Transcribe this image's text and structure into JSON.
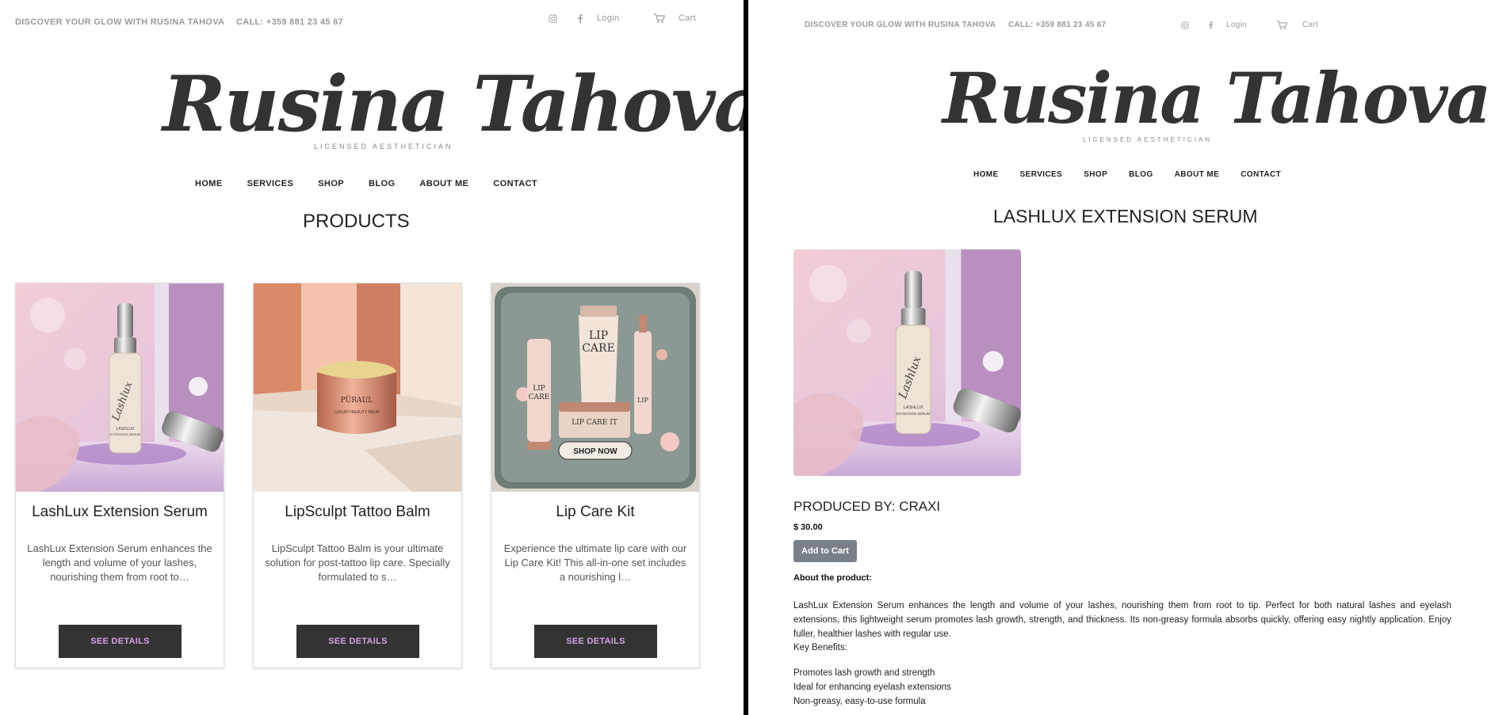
{
  "left": {
    "topbar": {
      "tagline": "DISCOVER YOUR GLOW WITH RUSINA TAHOVA",
      "phone": "CALL: +359 881 23 45 67",
      "login": "Login",
      "cart": "Cart"
    },
    "logo": {
      "name": "Rusina Tahova",
      "subtitle": "LICENSED AESTHETICIAN"
    },
    "nav": [
      "HOME",
      "SERVICES",
      "SHOP",
      "BLOG",
      "ABOUT ME",
      "CONTACT"
    ],
    "page_title": "PRODUCTS",
    "products": [
      {
        "title": "LashLux Extension Serum",
        "description": "LashLux Extension Serum enhances the length and volume of your lashes, nourishing them from root to…",
        "button": "SEE DETAILS",
        "image_label": "LASHLUX EXTENSION SERUM"
      },
      {
        "title": "LipSculpt Tattoo Balm",
        "description": "LipSculpt Tattoo Balm is your ultimate solution for post-tattoo lip care. Specially formulated to s…",
        "button": "SEE DETAILS",
        "image_label": "PURAUL LUXURY BEAUTY BALM"
      },
      {
        "title": "Lip Care Kit",
        "description": "Experience the ultimate lip care with our Lip Care Kit! This all-in-one set includes a nourishing l…",
        "button": "SEE DETAILS",
        "image_label": "SHOP NOW"
      }
    ]
  },
  "right": {
    "topbar": {
      "tagline": "DISCOVER YOUR GLOW WITH RUSINA TAHOVA",
      "phone": "CALL: +359 881 23 45 67",
      "login": "Login",
      "cart": "Cart"
    },
    "logo": {
      "name": "Rusina Tahova",
      "subtitle": "LICENSED AESTHETICIAN"
    },
    "nav": [
      "HOME",
      "SERVICES",
      "SHOP",
      "BLOG",
      "ABOUT ME",
      "CONTACT"
    ],
    "product_title": "LASHLUX EXTENSION SERUM",
    "producer": "PRODUCED BY: CRAXI",
    "price": "$ 30.00",
    "add_to_cart": "Add to Cart",
    "about_label": "About the product:",
    "description": "LashLux Extension Serum enhances the length and volume of your lashes, nourishing them from root to tip. Perfect for both natural lashes and eyelash extensions, this lightweight serum promotes lash growth, strength, and thickness. Its non-greasy formula absorbs quickly, offering easy nightly application. Enjoy fuller, healthier lashes with regular use.",
    "key_benefits_label": "Key Benefits:",
    "benefits": [
      "Promotes lash growth and strength",
      "Ideal for enhancing eyelash extensions",
      "Non-greasy, easy-to-use formula"
    ]
  },
  "colors": {
    "button_dark": "#333333",
    "button_text_purple": "#d6a0e6",
    "add_to_cart_gray": "#7a8087"
  }
}
